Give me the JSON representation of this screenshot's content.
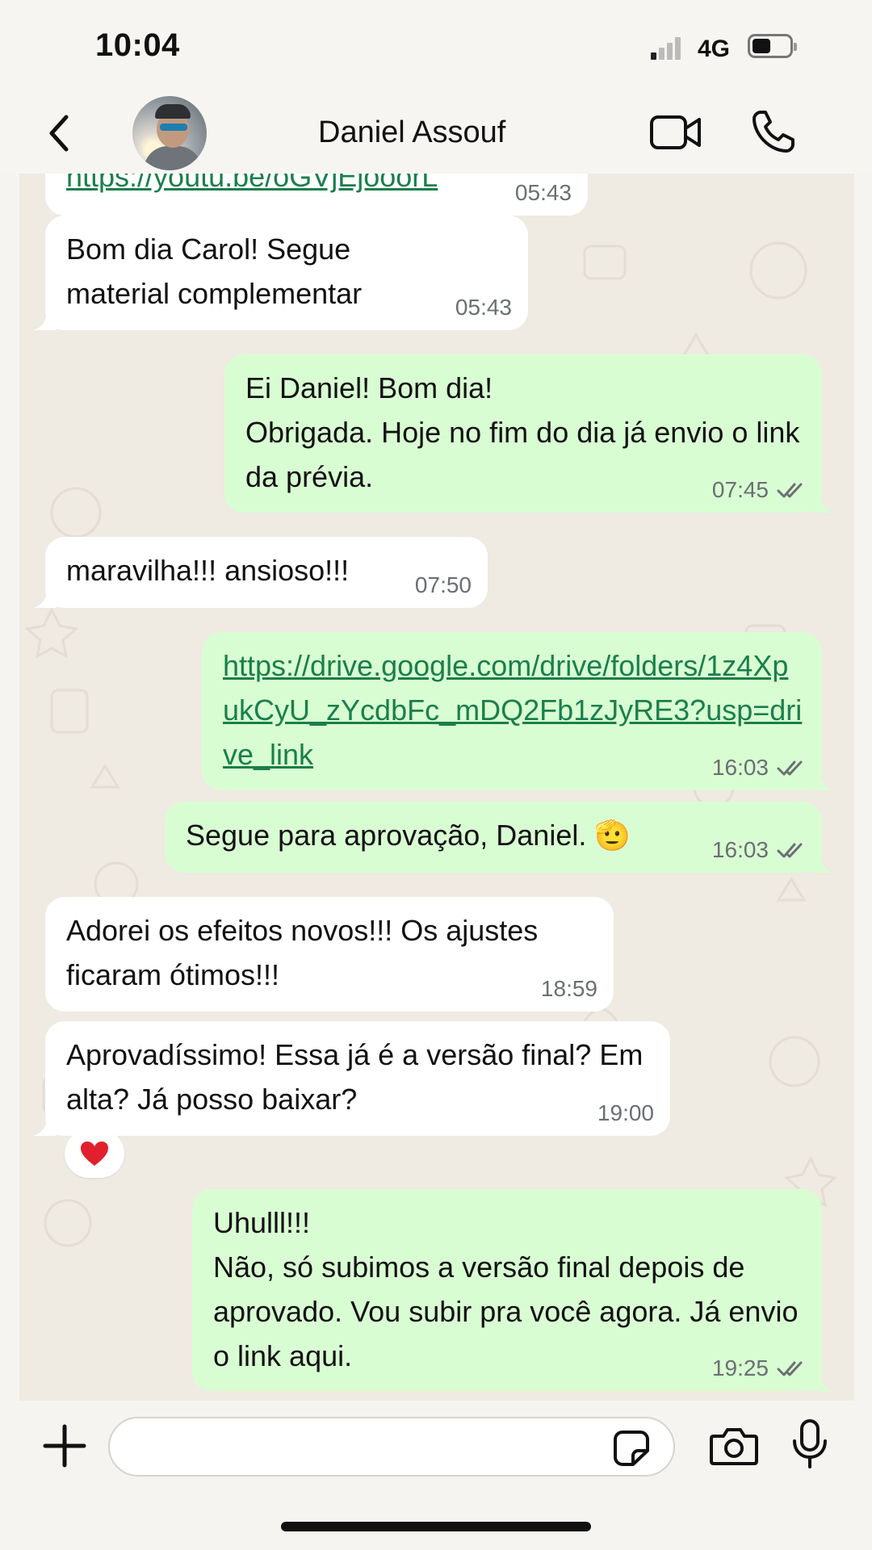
{
  "status_bar": {
    "time": "10:04",
    "network": "4G"
  },
  "header": {
    "contact_name": "Daniel Assouf"
  },
  "messages": [
    {
      "direction": "in",
      "text": "https://youtu.be/oGVjEjooorL",
      "time": "05:43",
      "is_link": true,
      "partial": true
    },
    {
      "direction": "in",
      "text": "Bom dia Carol! Segue material complementar",
      "time": "05:43"
    },
    {
      "direction": "out",
      "text": "Ei Daniel! Bom dia!\nObrigada. Hoje no fim do dia já envio o link da prévia.",
      "time": "07:45",
      "read": true
    },
    {
      "direction": "in",
      "text": "maravilha!!! ansioso!!!",
      "time": "07:50"
    },
    {
      "direction": "out",
      "text": "https://drive.google.com/drive/folders/1z4XpukCyU_zYcdbFc_mDQ2Fb1zJyRE3?usp=drive_link",
      "time": "16:03",
      "read": true,
      "is_link": true
    },
    {
      "direction": "out",
      "text": "Segue para aprovação, Daniel. 🫡",
      "time": "16:03",
      "read": true
    },
    {
      "direction": "in",
      "text": "Adorei os efeitos novos!!! Os ajustes ficaram ótimos!!!",
      "time": "18:59"
    },
    {
      "direction": "in",
      "text": "Aprovadíssimo! Essa já é a versão final? Em alta? Já posso baixar?",
      "time": "19:00",
      "reaction": "heart"
    },
    {
      "direction": "out",
      "text": "Uhulll!!!\nNão, só subimos a versão final depois de aprovado. Vou subir pra você agora. Já envio o link aqui.",
      "time": "19:25",
      "read": true
    }
  ],
  "input": {
    "placeholder": ""
  },
  "icons": {
    "back": "chevron-left-icon",
    "video": "video-camera-icon",
    "call": "phone-icon",
    "plus": "plus-icon",
    "sticker": "sticker-icon",
    "camera": "camera-icon",
    "mic": "microphone-icon",
    "read_receipt": "double-check-icon"
  },
  "colors": {
    "incoming_bubble": "#ffffff",
    "outgoing_bubble": "#d9fdd3",
    "link": "#1a7f4b",
    "timestamp": "#6b6f72",
    "wallpaper": "#efeae2"
  }
}
